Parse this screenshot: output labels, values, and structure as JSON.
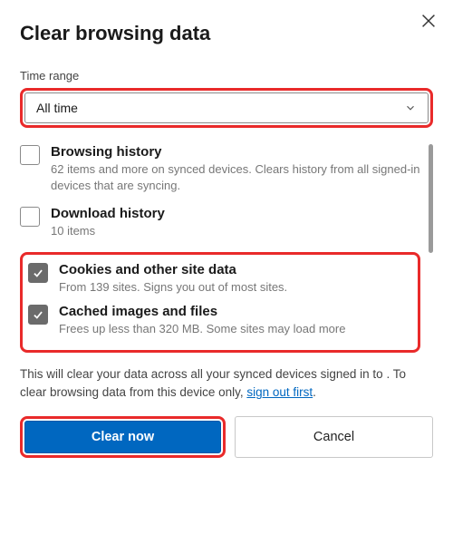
{
  "dialog": {
    "title": "Clear browsing data",
    "time_range_label": "Time range",
    "time_range_value": "All time"
  },
  "items": [
    {
      "title": "Browsing history",
      "desc": "62 items and more on synced devices. Clears history from all signed-in devices that are syncing.",
      "checked": false
    },
    {
      "title": "Download history",
      "desc": "10 items",
      "checked": false
    },
    {
      "title": "Cookies and other site data",
      "desc": "From 139 sites. Signs you out of most sites.",
      "checked": true
    },
    {
      "title": "Cached images and files",
      "desc": "Frees up less than 320 MB. Some sites may load more",
      "checked": true
    }
  ],
  "footnote": {
    "part1": "This will clear your data across all your synced devices signed in to ",
    "part2": ". To clear browsing data from this device only, ",
    "link": "sign out first",
    "suffix": "."
  },
  "actions": {
    "primary": "Clear now",
    "secondary": "Cancel"
  }
}
